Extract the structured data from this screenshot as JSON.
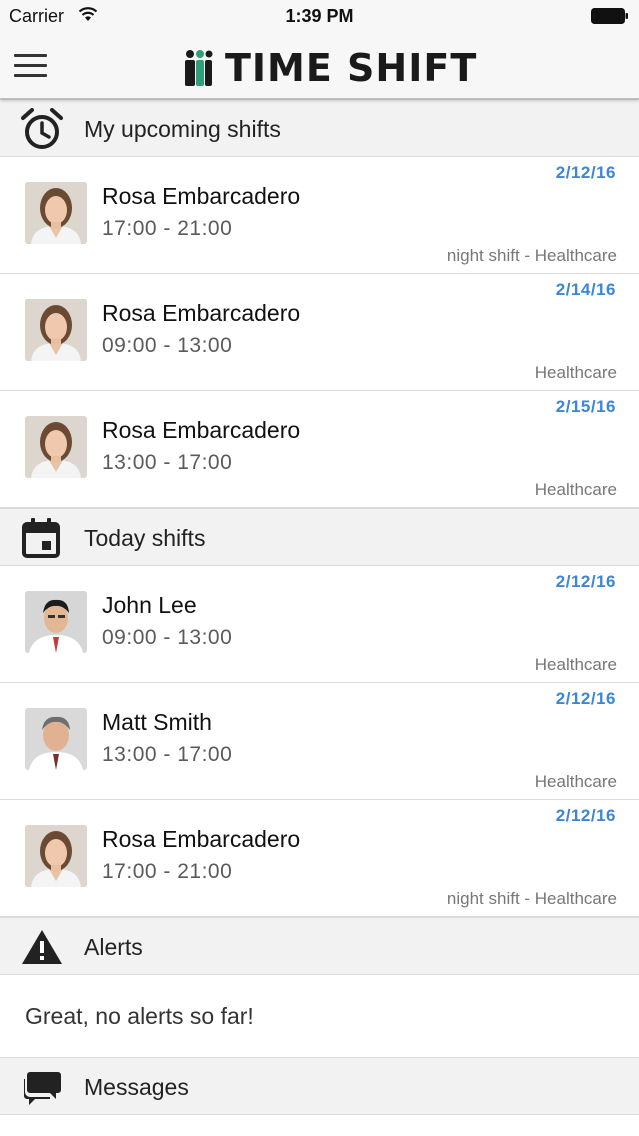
{
  "status_bar": {
    "carrier": "Carrier",
    "time": "1:39 PM"
  },
  "nav": {
    "title": "TIME SHIFT",
    "menu_icon": "hamburger-menu-icon",
    "logo_icon": "people-logo-icon",
    "colors": {
      "logo_green": "#2f9e7a",
      "title": "#1a1a1a"
    }
  },
  "sections": {
    "upcoming": {
      "title": "My upcoming shifts",
      "icon": "alarm-clock-icon"
    },
    "today": {
      "title": "Today shifts",
      "icon": "calendar-icon"
    },
    "alerts": {
      "title": "Alerts",
      "icon": "warning-icon",
      "empty_text": "Great, no alerts so far!"
    },
    "messages": {
      "title": "Messages",
      "icon": "chat-bubbles-icon"
    }
  },
  "upcoming_shifts": [
    {
      "name": "Rosa Embarcadero",
      "time": "17:00 - 21:00",
      "date": "2/12/16",
      "tag": "night shift - Healthcare",
      "avatar": "woman"
    },
    {
      "name": "Rosa Embarcadero",
      "time": "09:00 - 13:00",
      "date": "2/14/16",
      "tag": "Healthcare",
      "avatar": "woman"
    },
    {
      "name": "Rosa Embarcadero",
      "time": "13:00 - 17:00",
      "date": "2/15/16",
      "tag": "Healthcare",
      "avatar": "woman"
    }
  ],
  "today_shifts": [
    {
      "name": "John Lee",
      "time": "09:00 - 13:00",
      "date": "2/12/16",
      "tag": "Healthcare",
      "avatar": "man-dark"
    },
    {
      "name": "Matt Smith",
      "time": "13:00 - 17:00",
      "date": "2/12/16",
      "tag": "Healthcare",
      "avatar": "man-gray"
    },
    {
      "name": "Rosa Embarcadero",
      "time": "17:00 - 21:00",
      "date": "2/12/16",
      "tag": "night shift - Healthcare",
      "avatar": "woman"
    }
  ],
  "colors": {
    "accent_date": "#3b86d6",
    "section_bg": "#f2f2f2"
  }
}
